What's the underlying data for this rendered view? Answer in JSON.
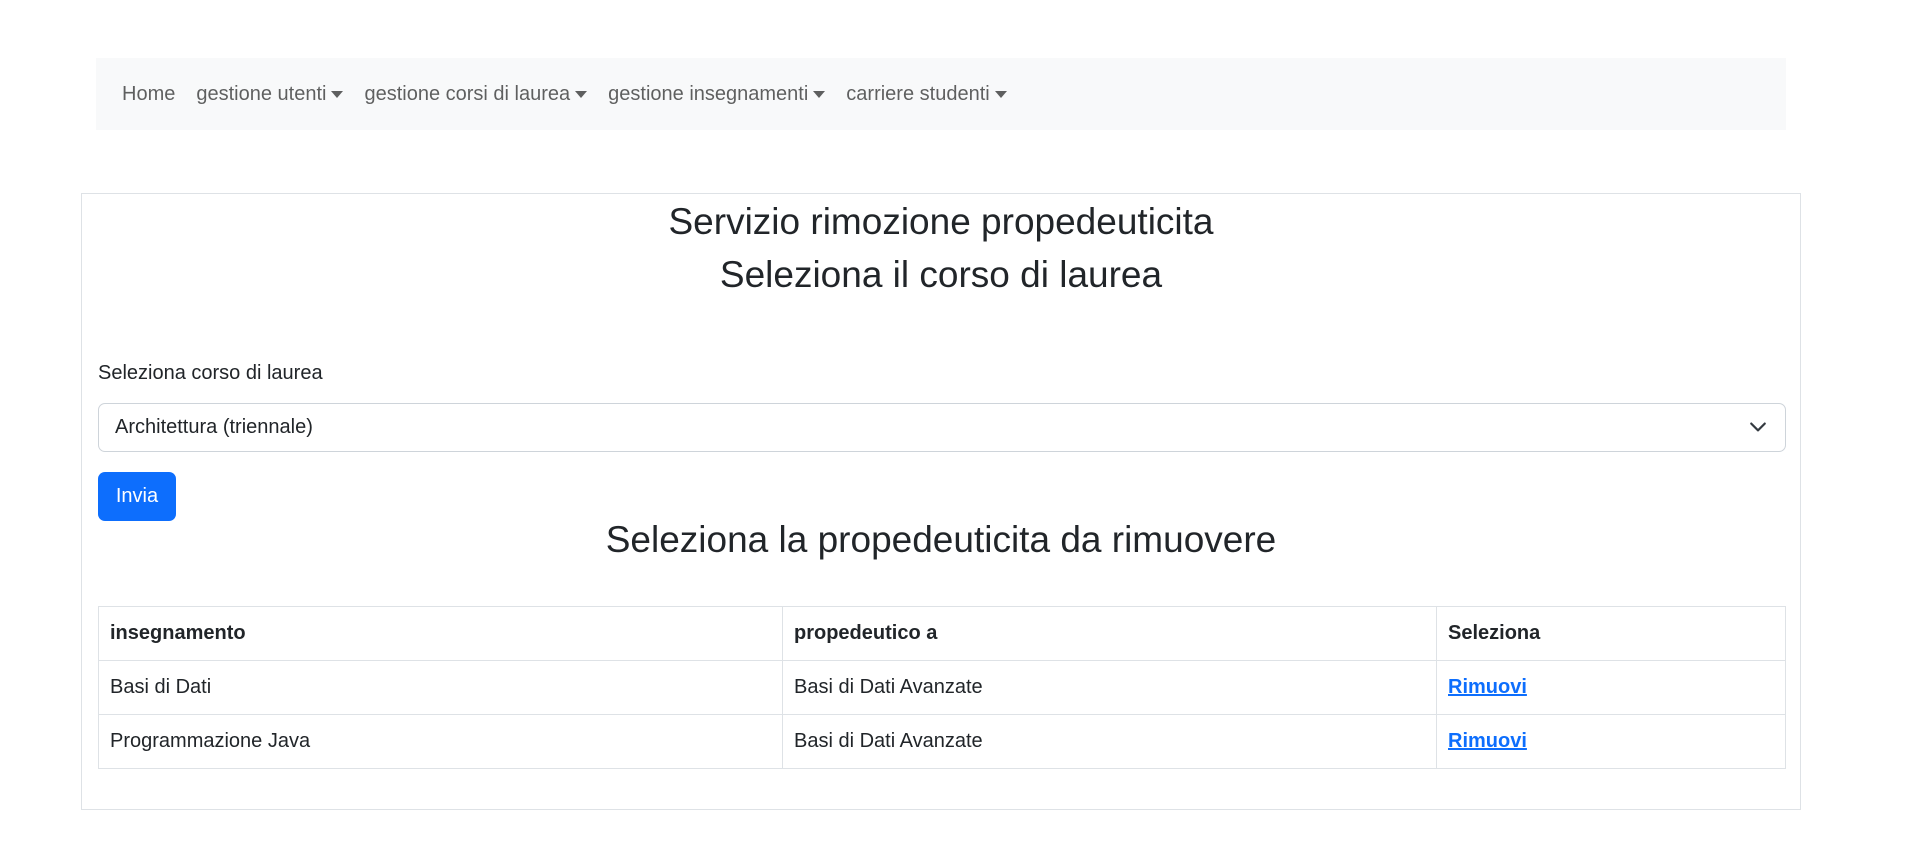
{
  "nav": {
    "home": "Home",
    "items": [
      {
        "label": "gestione utenti"
      },
      {
        "label": "gestione corsi di laurea"
      },
      {
        "label": "gestione insegnamenti"
      },
      {
        "label": "carriere studenti"
      }
    ]
  },
  "main": {
    "title": "Servizio rimozione propedeuticita",
    "subtitle": "Seleziona il corso di laurea",
    "select_label": "Seleziona corso di laurea",
    "select_value": "Architettura (triennale)",
    "submit_label": "Invia",
    "section_title": "Seleziona la propedeuticita da rimuovere"
  },
  "table": {
    "headers": [
      "insegnamento",
      "propedeutico a",
      "Seleziona"
    ],
    "rows": [
      {
        "insegnamento": "Basi di Dati",
        "propedeutico": "Basi di Dati Avanzate",
        "action": "Rimuovi"
      },
      {
        "insegnamento": "Programmazione Java",
        "propedeutico": "Basi di Dati Avanzate",
        "action": "Rimuovi"
      }
    ]
  },
  "colors": {
    "primary": "#0d6efd",
    "navbar_bg": "#f8f9fa",
    "border": "#dee2e6"
  },
  "icons": {
    "dropdown": "chevron-down-icon",
    "menu_caret": "caret-down-icon"
  }
}
